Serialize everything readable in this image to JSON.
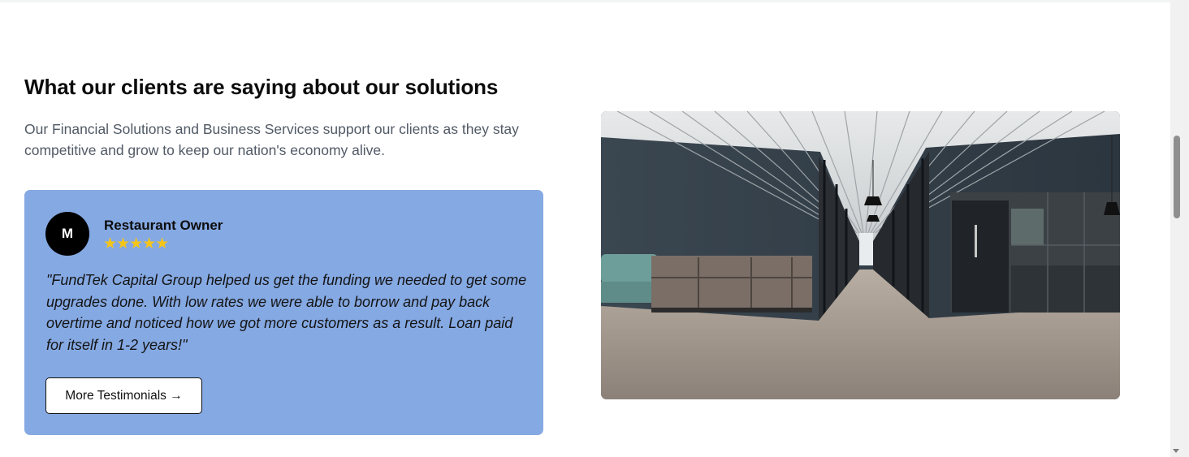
{
  "section": {
    "title": "What our clients are saying about our solutions",
    "description": "Our Financial Solutions and Business Services support our clients as they stay competitive and grow to keep our nation's economy alive."
  },
  "testimonial": {
    "avatar_initial": "M",
    "author_role": "Restaurant Owner",
    "rating": 5,
    "stars_text": "★★★★★",
    "quote": "\"FundTek Capital Group helped us get the funding we needed to get some upgrades done. With low rates we were able to borrow and pay back overtime and noticed how we got more customers as a result. Loan paid for itself in 1-2 years!\"",
    "button_label": "More Testimonials →"
  },
  "colors": {
    "card_background": "#85a9e3",
    "star": "#f5c518",
    "avatar_background": "#000000"
  }
}
